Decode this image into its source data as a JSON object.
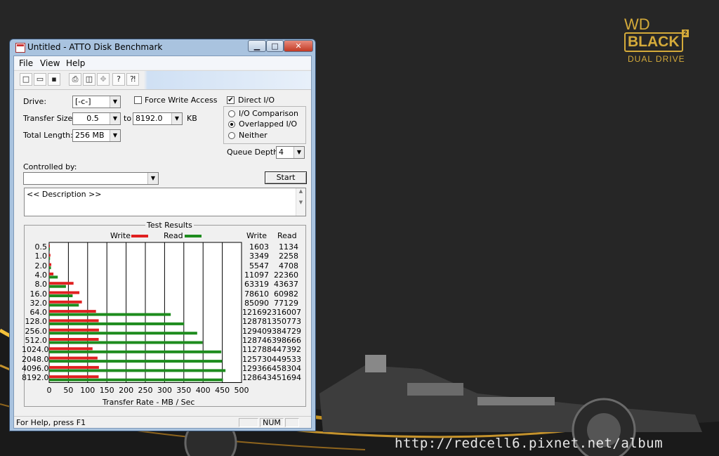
{
  "window": {
    "title": "Untitled - ATTO Disk Benchmark"
  },
  "menu": [
    "File",
    "View",
    "Help"
  ],
  "form": {
    "drive_label": "Drive:",
    "drive_value": "[-c-]",
    "force_write": "Force Write Access",
    "direct_io": "Direct I/O",
    "io_comparison": "I/O Comparison",
    "overlapped_io": "Overlapped I/O",
    "neither": "Neither",
    "transfer_size_label": "Transfer Size:",
    "transfer_from": "0.5",
    "to_label": "to",
    "transfer_to": "8192.0",
    "kb_label": "KB",
    "total_length_label": "Total Length:",
    "total_length_value": "256 MB",
    "queue_depth_label": "Queue Depth:",
    "queue_depth_value": "4",
    "controlled_by_label": "Controlled by:",
    "start_label": "Start",
    "description": "<< Description >>"
  },
  "chart_data": {
    "type": "bar",
    "title": "Test Results",
    "xlabel": "Transfer Rate - MB / Sec",
    "xlim": [
      0,
      500
    ],
    "xticks": [
      "0",
      "50",
      "100",
      "150",
      "200",
      "250",
      "300",
      "350",
      "400",
      "450",
      "500"
    ],
    "categories": [
      "0.5",
      "1.0",
      "2.0",
      "4.0",
      "8.0",
      "16.0",
      "32.0",
      "64.0",
      "128.0",
      "256.0",
      "512.0",
      "1024.0",
      "2048.0",
      "4096.0",
      "8192.0"
    ],
    "series": [
      {
        "name": "Write",
        "color": "#e02020",
        "values": [
          1603,
          3349,
          5547,
          11097,
          63319,
          78610,
          85090,
          121692,
          128781,
          129409,
          128746,
          112788,
          125730,
          129366,
          128643
        ]
      },
      {
        "name": "Read",
        "color": "#1e8c1e",
        "values": [
          1134,
          2258,
          4708,
          22360,
          43637,
          60982,
          77129,
          316007,
          350773,
          384729,
          398666,
          447392,
          449533,
          458304,
          451694
        ]
      }
    ],
    "column_headers": [
      "Write",
      "Read"
    ]
  },
  "status": {
    "help": "For Help, press F1",
    "num": "NUM"
  },
  "brand": {
    "line1": "WD",
    "line2": "BLACK",
    "sup": "2",
    "line3": "DUAL DRIVE",
    "color": "#d4aa3a"
  },
  "watermark": "http://redcell6.pixnet.net/album"
}
